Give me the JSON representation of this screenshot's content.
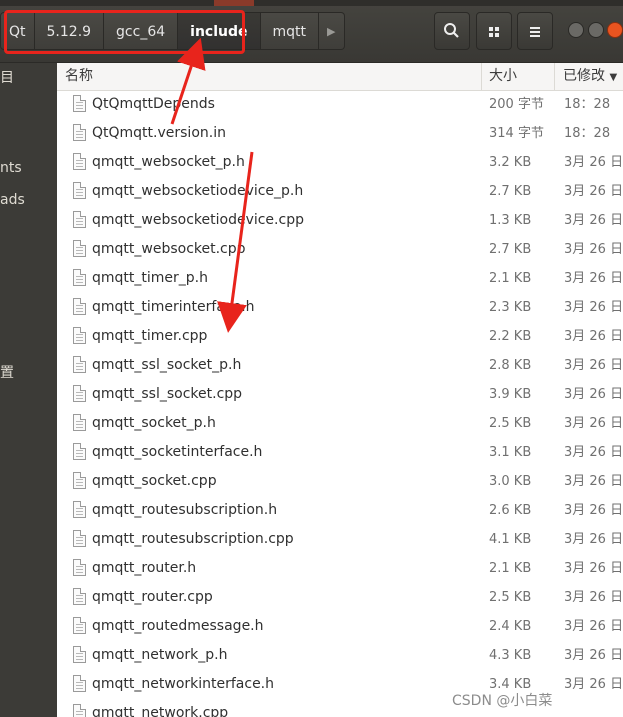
{
  "path_bar": {
    "crumbs": [
      "Qt",
      "5.12.9",
      "gcc_64",
      "include",
      "mqtt"
    ],
    "active_crumb": "include"
  },
  "toolbar": {
    "search_icon": "search-icon",
    "view_icon": "grid-view-icon",
    "menu_icon": "hamburger-menu-icon"
  },
  "sidebar": {
    "items": [
      "目",
      "nts",
      "ads",
      "置"
    ]
  },
  "columns": {
    "name": "名称",
    "size": "大小",
    "modified": "已修改"
  },
  "files": [
    {
      "name": "QtQmqttDepends",
      "size": "200 字节",
      "modified": "18：28"
    },
    {
      "name": "QtQmqtt.version.in",
      "size": "314 字节",
      "modified": "18：28"
    },
    {
      "name": "qmqtt_websocket_p.h",
      "size": "3.2 KB",
      "modified": "3月 26 日"
    },
    {
      "name": "qmqtt_websocketiodevice_p.h",
      "size": "2.7 KB",
      "modified": "3月 26 日"
    },
    {
      "name": "qmqtt_websocketiodevice.cpp",
      "size": "1.3 KB",
      "modified": "3月 26 日"
    },
    {
      "name": "qmqtt_websocket.cpp",
      "size": "2.7 KB",
      "modified": "3月 26 日"
    },
    {
      "name": "qmqtt_timer_p.h",
      "size": "2.1 KB",
      "modified": "3月 26 日"
    },
    {
      "name": "qmqtt_timerinterface.h",
      "size": "2.3 KB",
      "modified": "3月 26 日"
    },
    {
      "name": "qmqtt_timer.cpp",
      "size": "2.2 KB",
      "modified": "3月 26 日"
    },
    {
      "name": "qmqtt_ssl_socket_p.h",
      "size": "2.8 KB",
      "modified": "3月 26 日"
    },
    {
      "name": "qmqtt_ssl_socket.cpp",
      "size": "3.9 KB",
      "modified": "3月 26 日"
    },
    {
      "name": "qmqtt_socket_p.h",
      "size": "2.5 KB",
      "modified": "3月 26 日"
    },
    {
      "name": "qmqtt_socketinterface.h",
      "size": "3.1 KB",
      "modified": "3月 26 日"
    },
    {
      "name": "qmqtt_socket.cpp",
      "size": "3.0 KB",
      "modified": "3月 26 日"
    },
    {
      "name": "qmqtt_routesubscription.h",
      "size": "2.6 KB",
      "modified": "3月 26 日"
    },
    {
      "name": "qmqtt_routesubscription.cpp",
      "size": "4.1 KB",
      "modified": "3月 26 日"
    },
    {
      "name": "qmqtt_router.h",
      "size": "2.1 KB",
      "modified": "3月 26 日"
    },
    {
      "name": "qmqtt_router.cpp",
      "size": "2.5 KB",
      "modified": "3月 26 日"
    },
    {
      "name": "qmqtt_routedmessage.h",
      "size": "2.4 KB",
      "modified": "3月 26 日"
    },
    {
      "name": "qmqtt_network_p.h",
      "size": "4.3 KB",
      "modified": "3月 26 日"
    },
    {
      "name": "qmqtt_networkinterface.h",
      "size": "3.4 KB",
      "modified": "3月 26 日"
    },
    {
      "name": "qmqtt_network.cpp",
      "size": "",
      "modified": ""
    }
  ],
  "watermark": "CSDN @小白菜",
  "colors": {
    "annotation_red": "#e8241c",
    "close_button": "#e95420",
    "header_bg": "#3c3b37"
  }
}
